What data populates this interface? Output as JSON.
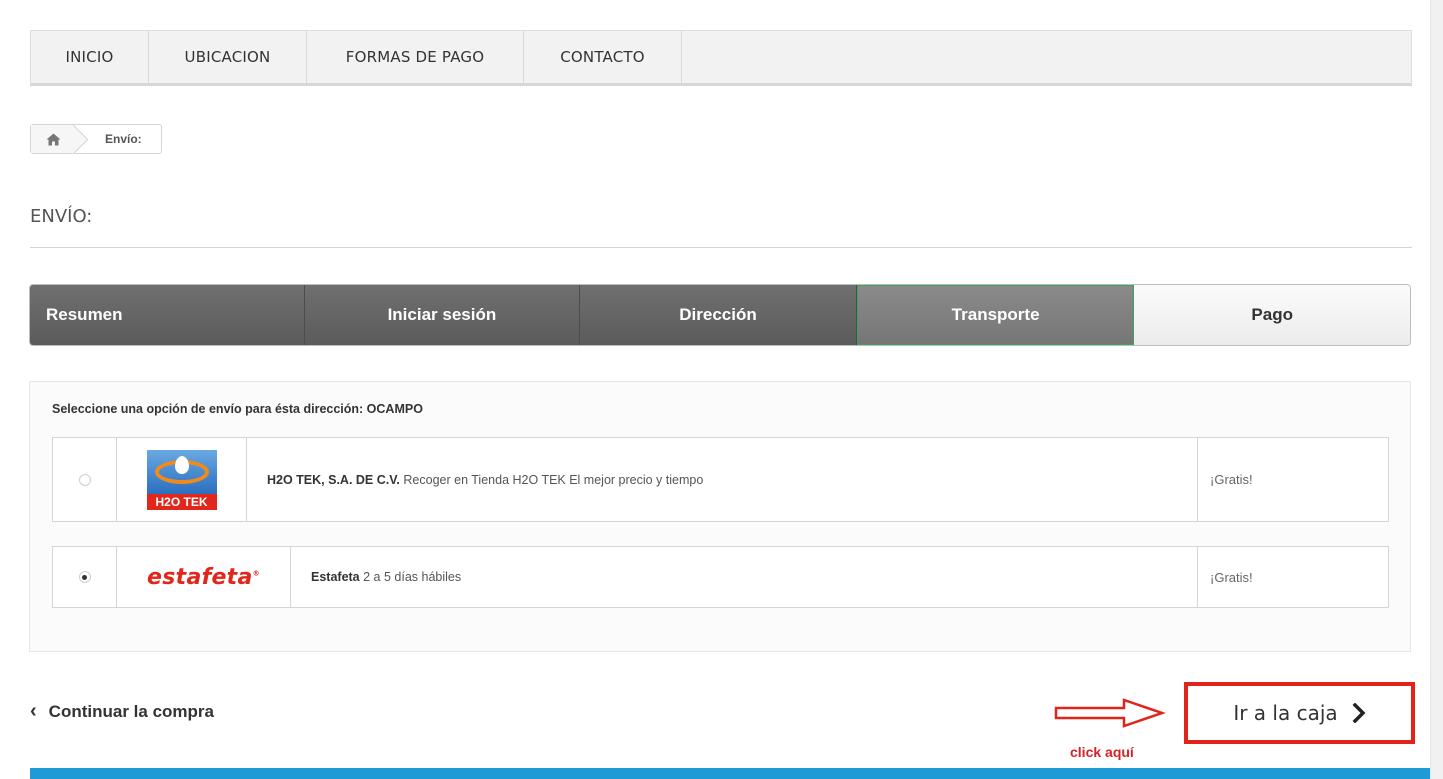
{
  "nav": {
    "items": [
      {
        "label": "INICIO",
        "width": 118
      },
      {
        "label": "UBICACION",
        "width": 158
      },
      {
        "label": "FORMAS DE PAGO",
        "width": 217
      },
      {
        "label": "CONTACTO",
        "width": 158
      }
    ]
  },
  "breadcrumb": {
    "home_icon": "home-icon",
    "current": "Envío:"
  },
  "page": {
    "heading": "ENVÍO:"
  },
  "steps": [
    {
      "label": "Resumen",
      "state": "done"
    },
    {
      "label": "Iniciar sesión",
      "state": "done"
    },
    {
      "label": "Dirección",
      "state": "done"
    },
    {
      "label": "Transporte",
      "state": "current"
    },
    {
      "label": "Pago",
      "state": "todo"
    }
  ],
  "delivery": {
    "label": "Seleccione una opción de envío para ésta dirección: OCAMPO",
    "options": [
      {
        "carrier": "H2O TEK, S.A. DE C.V.",
        "description": "Recoger en Tienda H2O TEK El mejor precio y tiempo",
        "price": "¡Gratis!",
        "selected": false,
        "logo_text": "H2O TEK"
      },
      {
        "carrier": "Estafeta",
        "description": "2 a 5 días hábiles",
        "price": "¡Gratis!",
        "selected": true,
        "logo_text": "estafeta"
      }
    ]
  },
  "actions": {
    "continue_label": "Continuar la compra",
    "checkout_label": "Ir a la caja",
    "hint": "click aquí"
  },
  "colors": {
    "step_done": "#636363",
    "step_current_border": "#3ea35a",
    "highlight_red": "#e2231a",
    "footer_blue": "#1e9ad6"
  }
}
